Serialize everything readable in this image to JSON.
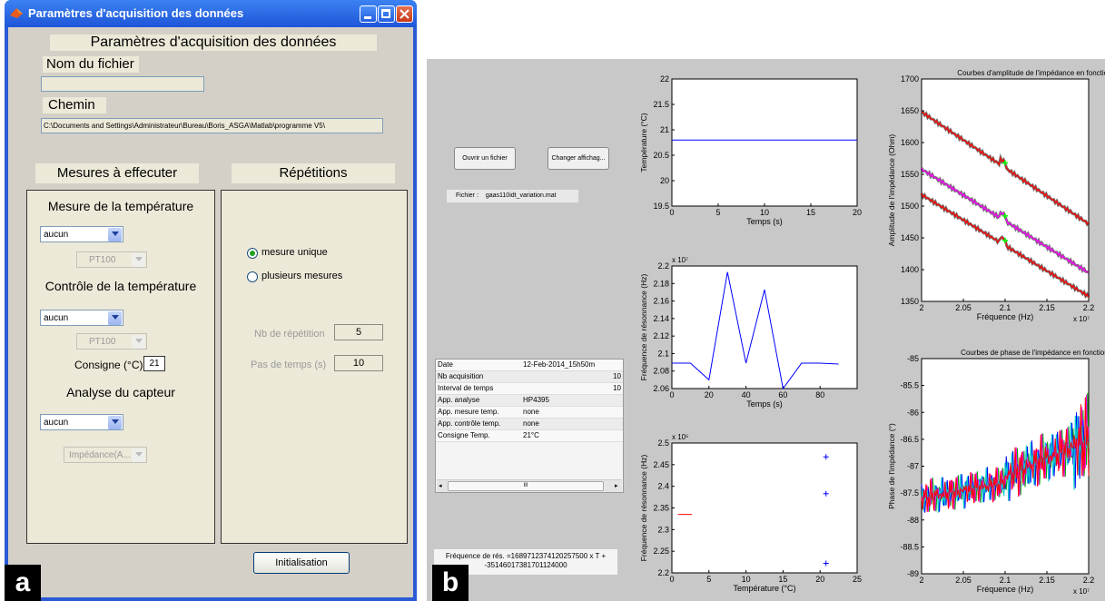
{
  "panel_a": {
    "badge": "a",
    "window_title": "Paramètres d'acquisition des données",
    "header": "Paramètres d'acquisition des données",
    "filename_label": "Nom du fichier",
    "filename_value": "",
    "path_label": "Chemin",
    "path_value": "C:\\Documents and Settings\\Administrateur\\Bureau\\Boris_ASGA\\Matlab\\programme V5\\",
    "measures_header": "Mesures à effecuter",
    "repetitions_header": "Répétitions",
    "temp_measure_label": "Mesure de la température",
    "temp_measure_value": "aucun",
    "temp_measure_sensor": "PT100",
    "temp_control_label": "Contrôle de la température",
    "temp_control_value": "aucun",
    "temp_control_sensor": "PT100",
    "setpoint_label": "Consigne (°C)",
    "setpoint_value": "21",
    "sensor_analysis_label": "Analyse du capteur",
    "sensor_analysis_value": "aucun",
    "sensor_analysis_mode": "Impédance(A...",
    "radio_single": "mesure unique",
    "radio_multiple": "plusieurs mesures",
    "radio_selected": "single",
    "nb_rep_label": "Nb de répétition",
    "nb_rep_value": "5",
    "time_step_label": "Pas de temps (s)",
    "time_step_value": "10",
    "init_button": "Initialisation"
  },
  "panel_b": {
    "badge": "b",
    "open_button": "Ouvrir un fichier",
    "change_button": "Changer affichag...",
    "file_label": "Fichier :",
    "file_value": "gaas110idt_variation.mat",
    "table_rows": [
      {
        "key": "Date",
        "value": "12-Feb-2014_15h50m"
      },
      {
        "key": "Nb acquisition",
        "value": "10"
      },
      {
        "key": "Interval de temps",
        "value": "10"
      },
      {
        "key": "App. analyse",
        "value": "HP4395"
      },
      {
        "key": "App. mesure temp.",
        "value": "none"
      },
      {
        "key": "App. contrôle temp.",
        "value": "none"
      },
      {
        "key": "Consigne Temp.",
        "value": "21°C"
      }
    ],
    "scroll_thumb": "III",
    "fit_text_line1": "Fréquence de rés. =1689712374120257500 x T +",
    "fit_text_line2": "-35146017381701124000"
  },
  "colors": {
    "blue_series": "#0000ff",
    "red_series": "#ff0000",
    "magenta_series": "#ff00ff",
    "cyan_marker": "#00ffff",
    "green_marker": "#00ff00",
    "xp_title": "#2a5bd5"
  },
  "chart_data": [
    {
      "type": "line",
      "xlabel": "Temps (s)",
      "ylabel": "Température (°C)",
      "xlim": [
        0,
        20
      ],
      "ylim": [
        19.5,
        22
      ],
      "xticks": [
        "0",
        "5",
        "10",
        "15",
        "20"
      ],
      "yticks": [
        "19.5",
        "20",
        "20.5",
        "21",
        "21.5",
        "22"
      ],
      "series": [
        {
          "x": [
            0,
            20
          ],
          "y": [
            20.8,
            20.8
          ]
        }
      ]
    },
    {
      "type": "line",
      "xlabel": "Temps (s)",
      "ylabel": "Fréquence de résonnance (Hz)",
      "xlim": [
        0,
        100
      ],
      "ylim": [
        2.06,
        2.2
      ],
      "y_scale_label": "x 10⁷",
      "xticks": [
        "0",
        "20",
        "40",
        "60",
        "80"
      ],
      "yticks": [
        "2.06",
        "2.08",
        "2.1",
        "2.12",
        "2.14",
        "2.16",
        "2.18",
        "2.2"
      ],
      "series": [
        {
          "x": [
            0,
            10,
            20,
            30,
            40,
            50,
            60,
            70,
            80,
            90
          ],
          "y": [
            2.089,
            2.089,
            2.07,
            2.193,
            2.089,
            2.173,
            2.06,
            2.089,
            2.089,
            2.088
          ]
        }
      ]
    },
    {
      "type": "scatter",
      "xlabel": "Température (°C)",
      "ylabel": "Fréquence de résonnance (Hz)",
      "xlim": [
        0,
        25
      ],
      "ylim": [
        2.2,
        2.5
      ],
      "y_scale_label": "x 10⁵",
      "xticks": [
        "0",
        "5",
        "10",
        "15",
        "20",
        "25"
      ],
      "yticks": [
        "2.2",
        "2.25",
        "2.3",
        "2.35",
        "2.4",
        "2.45",
        "2.5"
      ],
      "series": [
        {
          "points": [
            [
              20.8,
              2.468
            ],
            [
              20.8,
              2.383
            ],
            [
              20.8,
              2.222
            ]
          ]
        },
        {
          "line": [
            [
              0.8,
              2.335
            ],
            [
              2.7,
              2.335
            ]
          ]
        }
      ]
    },
    {
      "type": "line",
      "title": "Courbes d'amplitude de l'impédance en fonction du temps",
      "xlabel": "Fréquence (Hz)",
      "ylabel": "Amplitude de l'impédance (Ohm)",
      "xlim": [
        2,
        2.2
      ],
      "ylim": [
        1350,
        1700
      ],
      "x_scale_label": "x 10⁷",
      "xticks": [
        "2",
        "2.05",
        "2.1",
        "2.15",
        "2.2"
      ],
      "yticks": [
        "1350",
        "1400",
        "1450",
        "1500",
        "1550",
        "1600",
        "1650",
        "1700"
      ],
      "series": [
        {
          "x": [
            2,
            2.2
          ],
          "y": [
            1648,
            1472
          ]
        },
        {
          "x": [
            2,
            2.2
          ],
          "y": [
            1558,
            1395
          ]
        },
        {
          "x": [
            2,
            2.2
          ],
          "y": [
            1518,
            1358
          ]
        }
      ]
    },
    {
      "type": "line",
      "title": "Courbes de phase de l'impédance en fonction du temps",
      "xlabel": "Fréquence (Hz)",
      "ylabel": "Phase de l'impédance (°)",
      "xlim": [
        2,
        2.2
      ],
      "ylim": [
        -89,
        -85
      ],
      "x_scale_label": "x 10⁷",
      "xticks": [
        "2",
        "2.05",
        "2.1",
        "2.15",
        "2.2"
      ],
      "yticks": [
        "-85",
        "-85.5",
        "-86",
        "-86.5",
        "-87",
        "-87.5",
        "-88",
        "-88.5",
        "-89"
      ],
      "series": [
        {
          "x": [
            2,
            2.1,
            2.2
          ],
          "y": [
            -87.6,
            -87.2,
            -86.5
          ]
        }
      ]
    }
  ]
}
